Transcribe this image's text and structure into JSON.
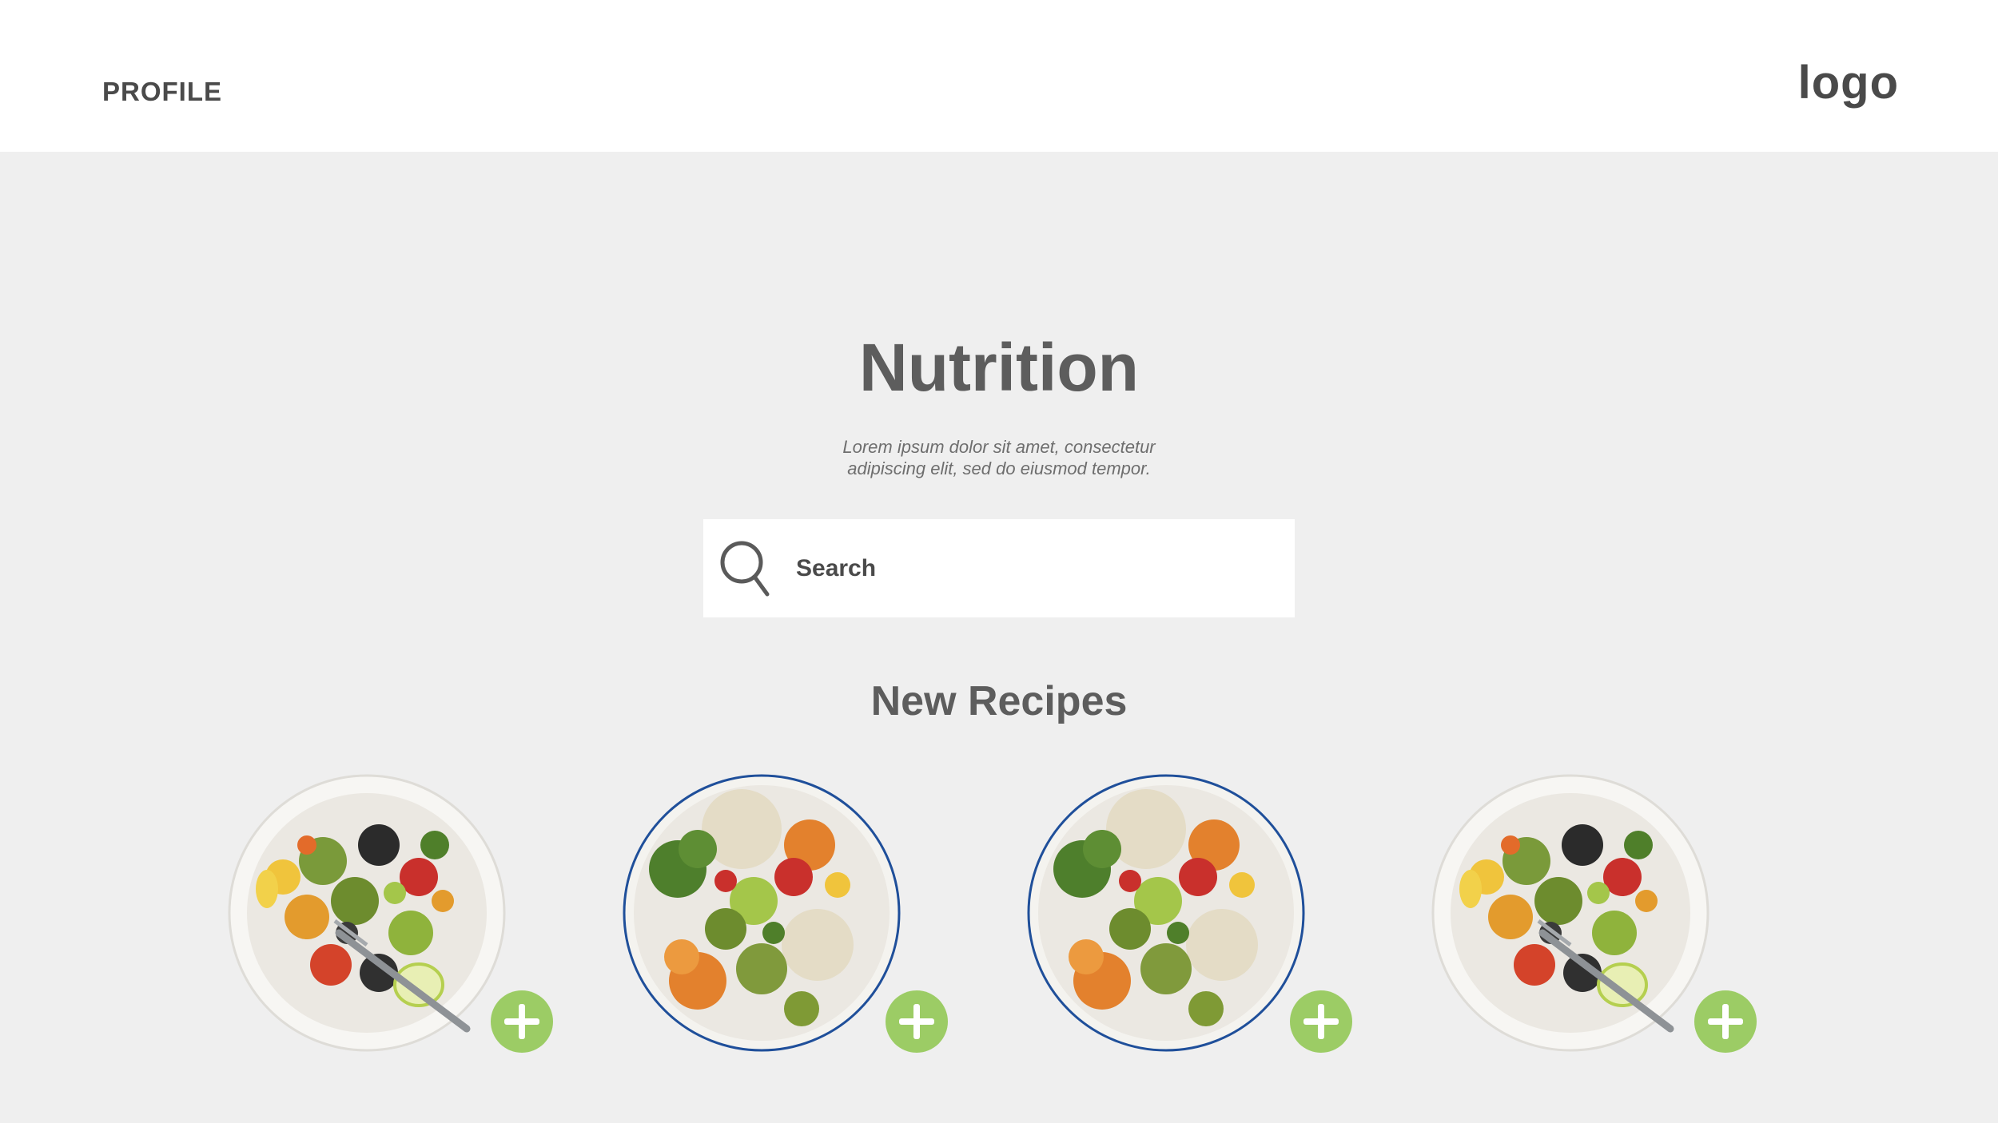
{
  "header": {
    "profile_label": "PROFILE",
    "logo_text": "logo"
  },
  "hero": {
    "title": "Nutrition",
    "subtitle_line1": "Lorem ipsum dolor sit amet, consectetur",
    "subtitle_line2": "adipiscing elit, sed do eiusmod tempor."
  },
  "search": {
    "placeholder": "Search",
    "icon": "search-icon"
  },
  "recipes": {
    "title": "New Recipes",
    "items": [
      {
        "dish": "black-bean-vegetable-plate"
      },
      {
        "dish": "quinoa-roasted-vegetable-bowl"
      },
      {
        "dish": "quinoa-roasted-vegetable-bowl"
      },
      {
        "dish": "black-bean-vegetable-plate"
      }
    ]
  },
  "colors": {
    "background": "#efefef",
    "header_bg": "#ffffff",
    "text_dark": "#4a4a4a",
    "text_title": "#5d5d5d",
    "accent_green": "#9ccc65"
  }
}
